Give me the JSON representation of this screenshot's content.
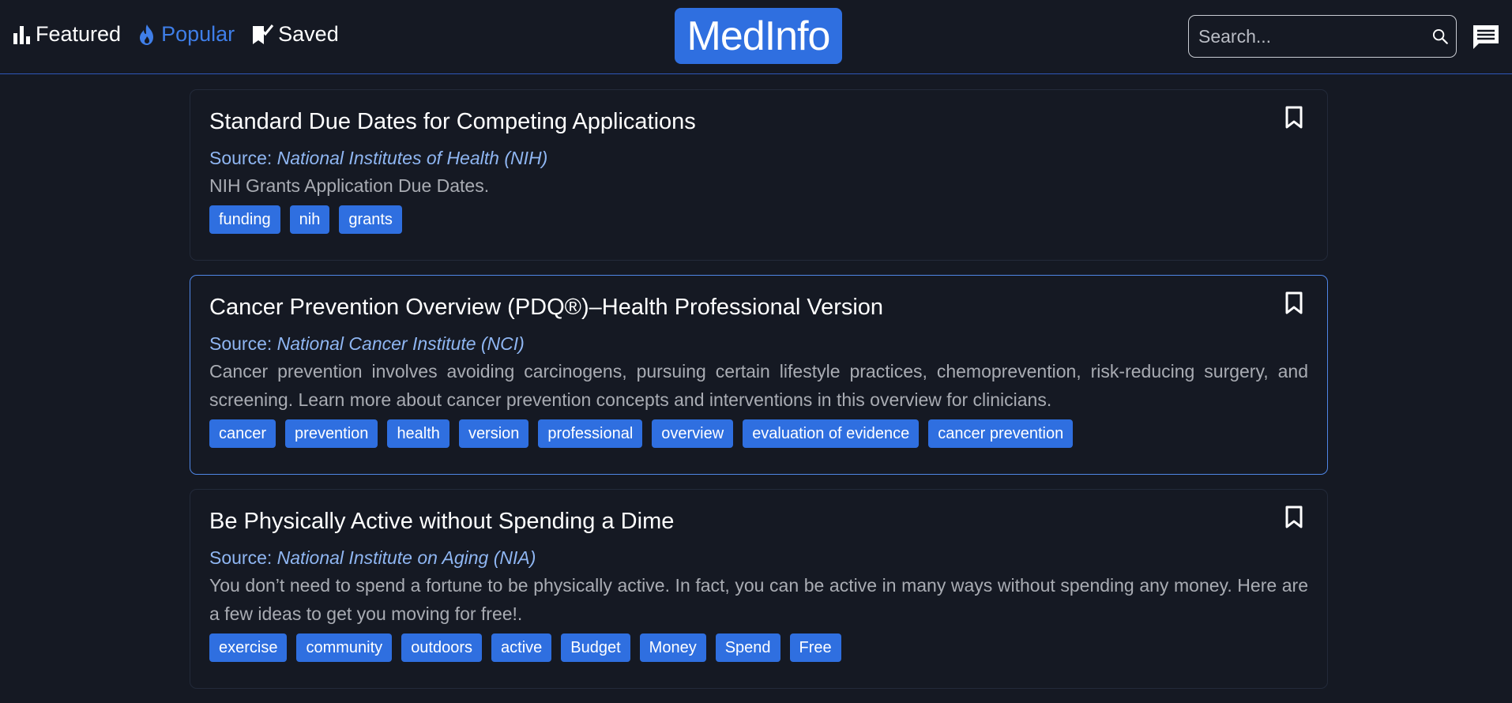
{
  "nav": {
    "featured": "Featured",
    "popular": "Popular",
    "saved": "Saved"
  },
  "logo": "MedInfo",
  "search": {
    "placeholder": "Search..."
  },
  "colors": {
    "accent": "#2f6fe0",
    "background": "#151923",
    "link": "#8fb6f2",
    "active_nav": "#3f7ee8"
  },
  "articles": [
    {
      "title": "Standard Due Dates for Competing Applications",
      "source_label": "Source: ",
      "source": "National Institutes of Health (NIH)",
      "description": "NIH Grants Application Due Dates.",
      "tags": [
        "funding",
        "nih",
        "grants"
      ]
    },
    {
      "title": "Cancer Prevention Overview (PDQ®)–Health Professional Version",
      "source_label": "Source: ",
      "source": "National Cancer Institute (NCI)",
      "description": "Cancer prevention involves avoiding carcinogens, pursuing certain lifestyle practices, chemoprevention, risk-reducing surgery, and screening. Learn more about cancer prevention concepts and interventions in this overview for clinicians.",
      "tags": [
        "cancer",
        "prevention",
        "health",
        "version",
        "professional",
        "overview",
        "evaluation of evidence",
        "cancer prevention"
      ]
    },
    {
      "title": "Be Physically Active without Spending a Dime",
      "source_label": "Source: ",
      "source": "National Institute on Aging (NIA)",
      "description": "You don’t need to spend a fortune to be physically active. In fact, you can be active in many ways without spending any money. Here are a few ideas to get you moving for free!.",
      "tags": [
        "exercise",
        "community",
        "outdoors",
        "active",
        "Budget",
        "Money",
        "Spend",
        "Free"
      ]
    }
  ]
}
